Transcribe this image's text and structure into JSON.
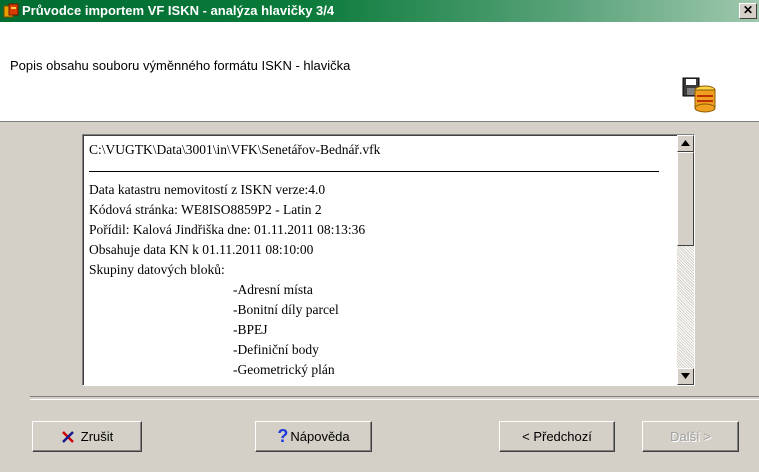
{
  "window": {
    "title": "Průvodce importem VF ISKN - analýza hlavičky 3/4",
    "close_label": "✕"
  },
  "header": {
    "subtitle": "Popis obsahu souboru výměnného formátu ISKN - hlavička"
  },
  "textbox": {
    "path": "C:\\VUGTK\\Data\\3001\\in\\VFK\\Senetářov-Bednář.vfk",
    "lines": [
      "Data katastru nemovitostí z ISKN verze:4.0",
      "Kódová stránka: WE8ISO8859P2 - Latin 2",
      "Pořídil: Kalová Jindřiška dne: 01.11.2011 08:13:36",
      "Obsahuje data KN k 01.11.2011 08:10:00",
      "Skupiny datových bloků:"
    ],
    "groups": [
      "-Adresní místa",
      "-Bonitní díly parcel",
      "-BPEJ",
      "-Definiční body",
      "-Geometrický plán"
    ]
  },
  "buttons": {
    "cancel": "Zrušit",
    "help": "Nápověda",
    "back": "< Předchozí",
    "next": "Další >"
  },
  "colors": {
    "titlebar_start": "#006c31",
    "face": "#d4d0c8"
  },
  "icons": {
    "app": "import-wizard-icon",
    "header": "database-icon",
    "cancel": "red-x-icon",
    "help": "question-mark-icon"
  }
}
